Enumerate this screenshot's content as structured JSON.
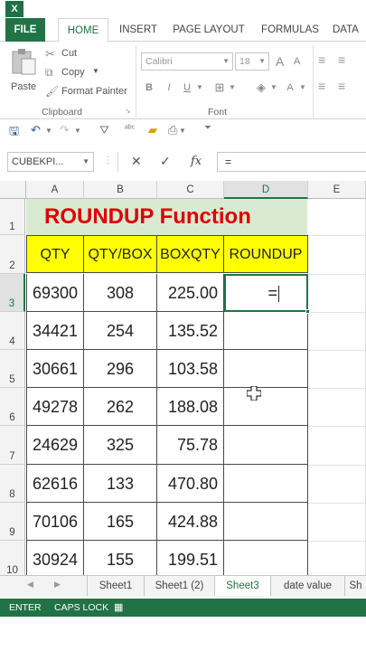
{
  "app": {
    "logo": "X",
    "tabs": [
      "FILE",
      "HOME",
      "INSERT",
      "PAGE LAYOUT",
      "FORMULAS",
      "DATA"
    ],
    "active_tab": "HOME",
    "accent_color": "#217346"
  },
  "ribbon": {
    "clipboard": {
      "paste_label": "Paste",
      "cut_label": "Cut",
      "copy_label": "Copy",
      "format_painter_label": "Format Painter",
      "group_label": "Clipboard"
    },
    "font": {
      "font_name": "Calibri",
      "font_size": "18",
      "grow": "A",
      "shrink": "A",
      "bold": "B",
      "italic": "I",
      "underline": "U",
      "font_color": "A",
      "group_label": "Font"
    }
  },
  "formula_bar": {
    "name_box": "CUBEKPI...",
    "cancel_icon": "✕",
    "enter_icon": "✓",
    "fx_label": "fx",
    "formula_value": "="
  },
  "grid": {
    "columns": [
      "A",
      "B",
      "C",
      "D",
      "E"
    ],
    "selected_column": "D",
    "rows": [
      "1",
      "2",
      "3",
      "4",
      "5",
      "6",
      "7",
      "8",
      "9",
      "10"
    ],
    "selected_row": "3",
    "title": "ROUNDUP Function",
    "headers": [
      "QTY",
      "QTY/BOX",
      "BOXQTY",
      "ROUNDUP"
    ],
    "data": [
      [
        "69300",
        "308",
        "225.00"
      ],
      [
        "34421",
        "254",
        "135.52"
      ],
      [
        "30661",
        "296",
        "103.58"
      ],
      [
        "49278",
        "262",
        "188.08"
      ],
      [
        "24629",
        "325",
        "75.78"
      ],
      [
        "62616",
        "133",
        "470.80"
      ],
      [
        "70106",
        "165",
        "424.88"
      ],
      [
        "30924",
        "155",
        "199.51"
      ]
    ],
    "active_cell_value": "=",
    "title_fill": "#d9ead3",
    "title_color": "#e00000",
    "header_fill": "#ffff00"
  },
  "sheets": {
    "tabs": [
      "Sheet1",
      "Sheet1 (2)",
      "Sheet3",
      "date value",
      "Sh"
    ]
  },
  "status": {
    "mode": "ENTER",
    "caps": "CAPS LOCK"
  }
}
